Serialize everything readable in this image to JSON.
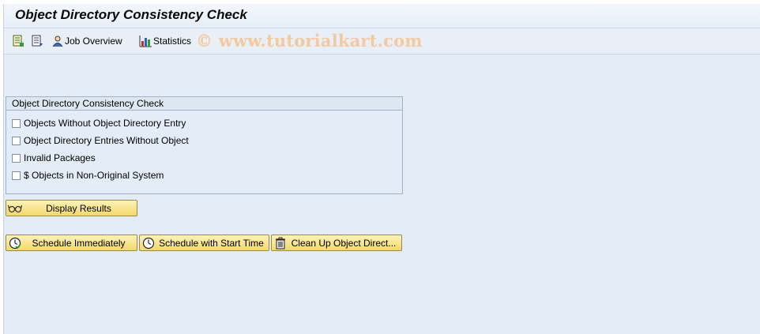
{
  "title": "Object Directory Consistency Check",
  "toolbar": {
    "job_overview_label": "Job Overview",
    "statistics_label": "Statistics",
    "watermark": "© www.tutorialkart.com"
  },
  "group": {
    "title": "Object Directory Consistency Check",
    "options": [
      {
        "label": "Objects Without Object Directory Entry",
        "checked": false
      },
      {
        "label": "Object Directory Entries Without Object",
        "checked": false
      },
      {
        "label": "Invalid Packages",
        "checked": false
      },
      {
        "label": "$ Objects in Non-Original System",
        "checked": false
      }
    ]
  },
  "buttons": {
    "display_results": "Display Results",
    "schedule_immediately": "Schedule Immediately",
    "schedule_start_time": "Schedule with Start Time",
    "clean_up": "Clean Up Object Direct..."
  },
  "colors": {
    "background": "#e4edf7",
    "button_fill": "#f3d96b",
    "watermark": "#f3c9a0"
  }
}
